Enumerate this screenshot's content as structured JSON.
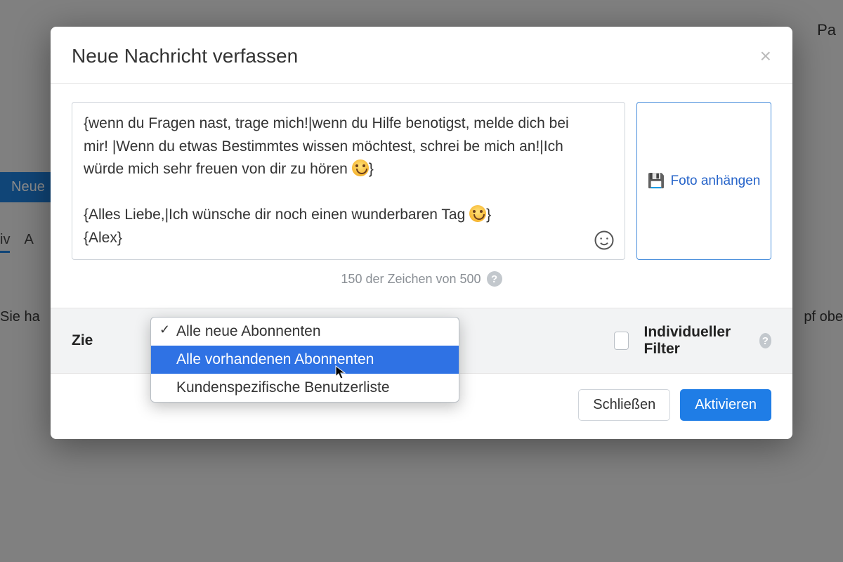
{
  "background": {
    "topright": "Pa",
    "tab_new": "Neue",
    "tab_iv": "iv",
    "tab_a": "A",
    "line_left": "Sie ha",
    "line_right": "pf obe"
  },
  "modal": {
    "title": "Neue Nachricht verfassen",
    "message": {
      "line1_a": "{wenn du Fragen nast, trage mich!|wenn du Hilfe benotigst, melde",
      "line2": "dich bei mir! |Wenn du etwas Bestimmtes wissen möchtest, schrei",
      "line3_a": "be mich an!|Ich würde mich sehr freuen von dir zu hören ",
      "line3_b": "}",
      "line5_a": "{Alles Liebe,|Ich wünsche dir noch einen wunderbaren Tag ",
      "line5_b": "}",
      "line6": "{Alex}"
    },
    "attach_label": "Foto anhängen",
    "char_counter": "150 der Zeichen von 500"
  },
  "target": {
    "label": "Zie",
    "filter_label": "Individueller Filter",
    "dropdown": {
      "opt1": "Alle neue Abonnenten",
      "opt2": "Alle vorhandenen Abonnenten",
      "opt3": "Kundenspezifische Benutzerliste"
    }
  },
  "footer": {
    "close": "Schließen",
    "activate": "Aktivieren"
  }
}
